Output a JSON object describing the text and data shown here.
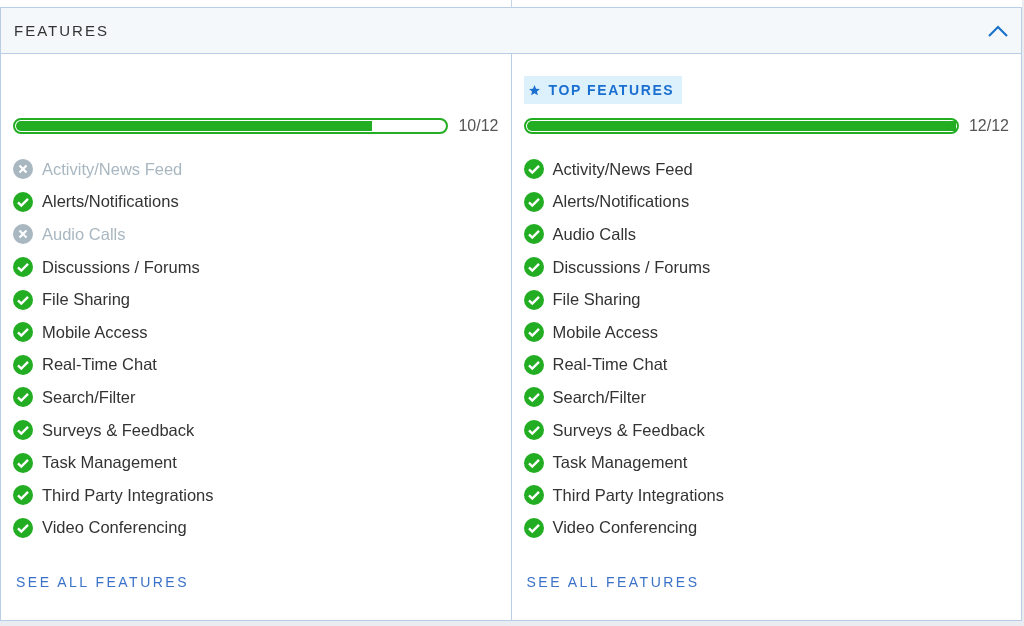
{
  "section": {
    "title": "FEATURES",
    "expanded": true
  },
  "columns": [
    {
      "level": 0.83,
      "count": "10/12",
      "features": [
        {
          "label": "Activity/News Feed",
          "available": false
        },
        {
          "label": "Alerts/Notifications",
          "available": true
        },
        {
          "label": "Audio Calls",
          "available": false
        },
        {
          "label": "Discussions / Forums",
          "available": true
        },
        {
          "label": "File Sharing",
          "available": true
        },
        {
          "label": "Mobile Access",
          "available": true
        },
        {
          "label": "Real-Time Chat",
          "available": true
        },
        {
          "label": "Search/Filter",
          "available": true
        },
        {
          "label": "Surveys & Feedback",
          "available": true
        },
        {
          "label": "Task Management",
          "available": true
        },
        {
          "label": "Third Party Integrations",
          "available": true
        },
        {
          "label": "Video Conferencing",
          "available": true
        }
      ],
      "link": "SEE ALL FEATURES"
    },
    {
      "badge": "TOP FEATURES",
      "level": 1,
      "count": "12/12",
      "features": [
        {
          "label": "Activity/News Feed",
          "available": true
        },
        {
          "label": "Alerts/Notifications",
          "available": true
        },
        {
          "label": "Audio Calls",
          "available": true
        },
        {
          "label": "Discussions / Forums",
          "available": true
        },
        {
          "label": "File Sharing",
          "available": true
        },
        {
          "label": "Mobile Access",
          "available": true
        },
        {
          "label": "Real-Time Chat",
          "available": true
        },
        {
          "label": "Search/Filter",
          "available": true
        },
        {
          "label": "Surveys & Feedback",
          "available": true
        },
        {
          "label": "Task Management",
          "available": true
        },
        {
          "label": "Third Party Integrations",
          "available": true
        },
        {
          "label": "Video Conferencing",
          "available": true
        }
      ],
      "link": "SEE ALL FEATURES"
    }
  ]
}
